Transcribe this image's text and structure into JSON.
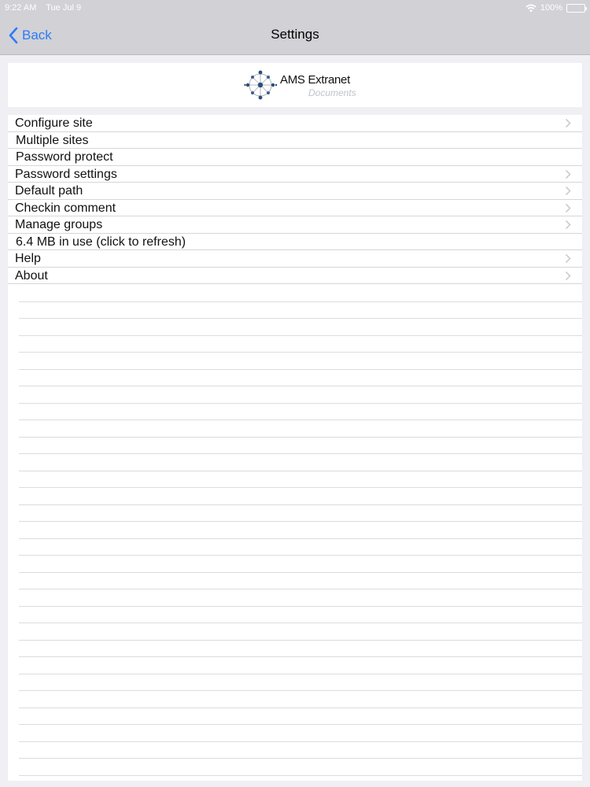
{
  "status_bar": {
    "time": "9:22 AM",
    "date": "Tue Jul 9",
    "battery_percent": "100%",
    "icons": [
      "wifi-icon",
      "battery-icon"
    ]
  },
  "nav": {
    "back_label": "Back",
    "title": "Settings",
    "accent_color": "#2f7bf5"
  },
  "logo": {
    "title": "AMS Extranet",
    "subtitle": "Documents"
  },
  "settings": {
    "items": [
      {
        "label": "Configure site",
        "chevron": true
      },
      {
        "label": "Multiple sites",
        "chevron": false
      },
      {
        "label": "Password protect",
        "chevron": false
      },
      {
        "label": "Password settings",
        "chevron": true
      },
      {
        "label": "Default path",
        "chevron": true
      },
      {
        "label": "Checkin comment",
        "chevron": true
      },
      {
        "label": "Manage groups",
        "chevron": true
      },
      {
        "label": "6.4 MB in use (click to refresh)",
        "chevron": false
      },
      {
        "label": "Help",
        "chevron": true
      },
      {
        "label": "About",
        "chevron": true
      }
    ]
  }
}
